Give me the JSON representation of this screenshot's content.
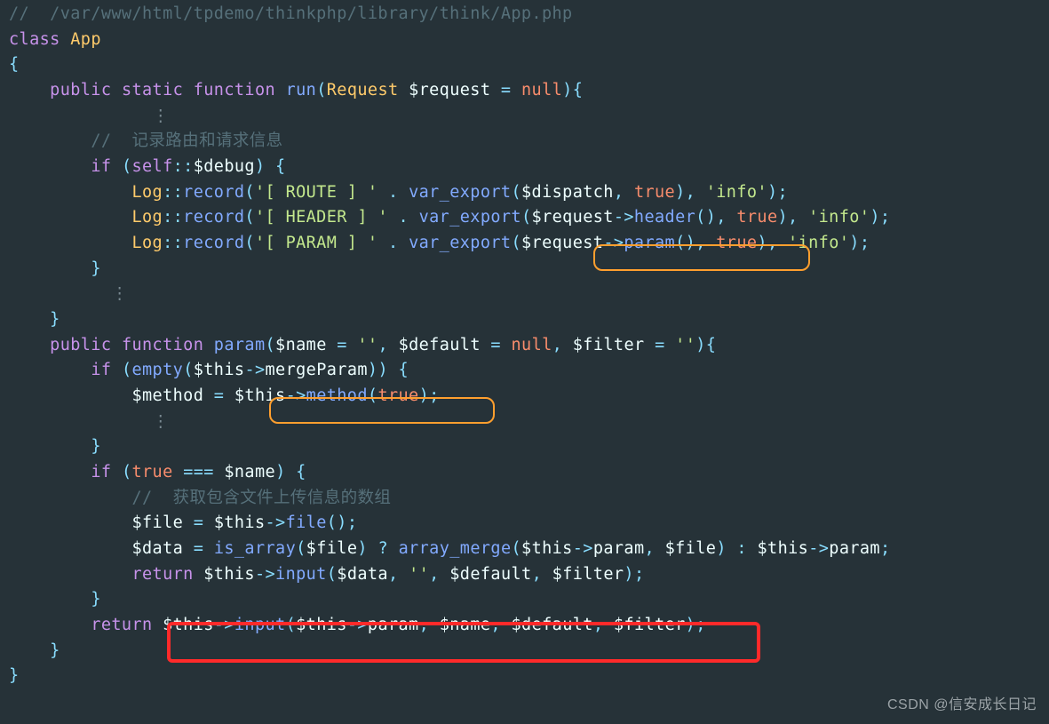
{
  "c01": "//  /var/www/html/tpdemo/thinkphp/library/think/App.php",
  "c02_class": "class",
  "c02_name": "App",
  "c03": "{",
  "c04_pub": "public",
  "c04_stat": "static",
  "c04_func": "function",
  "c04_run": "run",
  "c04_req": "Request",
  "c04_var": "$request",
  "c04_eq": " = ",
  "c04_null": "null",
  "c04_tail": "){",
  "c05_dots": "⋮",
  "c06": "//  记录路由和请求信息",
  "c07_if": "if",
  "c07_self": "self",
  "c07_dbg": "$debug",
  "c07_tail": ") {",
  "c08_log": "Log",
  "c08_rec": "record",
  "c08_s1": "'[ ROUTE ] '",
  "c08_ve": "var_export",
  "c08_dis": "$dispatch",
  "c08_true": "true",
  "c08_info": "'info'",
  "c09_s1": "'[ HEADER ] '",
  "c09_req": "$request",
  "c09_hdr": "header",
  "c10_s1": "'[ PARAM ] '",
  "c10_par": "param",
  "c11": "}",
  "c12_dots": "⋮",
  "c13": "}",
  "c14_pub": "public",
  "c14_func": "function",
  "c14_par": "param",
  "c14_name": "$name",
  "c14_e1": "''",
  "c14_def": "$default",
  "c14_null": "null",
  "c14_flt": "$filter",
  "c14_e2": "''",
  "c14_tail": "){",
  "c15_if": "if",
  "c15_emp": "empty",
  "c15_this": "$this",
  "c15_mp": "mergeParam",
  "c15_tail": ")) {",
  "c16_meth": "$method",
  "c16_this": "$this",
  "c16_m": "method",
  "c16_true": "true",
  "c17_dots": "⋮",
  "c18": "}",
  "c19_if": "if",
  "c19_true": "true",
  "c19_name": "$name",
  "c19_tail": ") {",
  "c20": "//  获取包含文件上传信息的数组",
  "c21_file": "$file",
  "c21_this": "$this",
  "c21_f": "file",
  "c22_data": "$data",
  "c22_isa": "is_array",
  "c22_file": "$file",
  "c22_am": "array_merge",
  "c22_this": "$this",
  "c22_par": "param",
  "c23_ret": "return",
  "c23_this": "$this",
  "c23_inp": "input",
  "c23_data": "$data",
  "c23_e": "''",
  "c23_def": "$default",
  "c23_flt": "$filter",
  "c24": "}",
  "c25_ret": "return",
  "c25_this": "$this",
  "c25_inp": "input",
  "c25_par": "param",
  "c25_name": "$name",
  "c25_def": "$default",
  "c25_flt": "$filter",
  "c26": "}",
  "c27": "}",
  "watermark": "CSDN @信安成长日记",
  "highlights": {
    "orange1": "$request->param()",
    "orange2": "$this->method(true)",
    "red": "$this->input($this->param, $name, $default, $filter);"
  }
}
